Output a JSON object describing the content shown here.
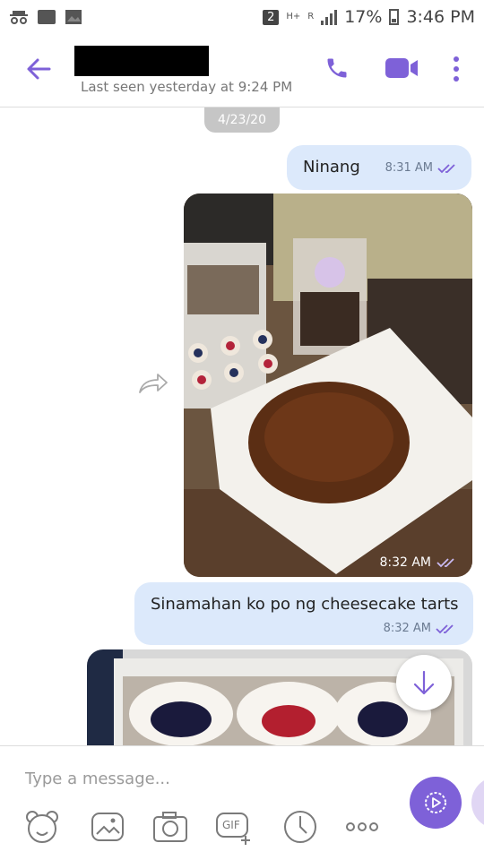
{
  "status_bar": {
    "notification_count": "2",
    "network_type": "H+",
    "roaming": "R",
    "battery": "17%",
    "time": "3:46 PM"
  },
  "header": {
    "last_seen": "Last seen yesterday at 9:24 PM",
    "icons": [
      "back-arrow-icon",
      "phone-icon",
      "video-icon",
      "more-vertical-icon"
    ],
    "accent_color": "#7e61d8"
  },
  "chat": {
    "date_label": "4/23/20",
    "messages": [
      {
        "type": "text",
        "text": "Ninang",
        "time": "8:31 AM",
        "status": "read"
      },
      {
        "type": "image",
        "time": "8:32 AM",
        "status": "read"
      },
      {
        "type": "text",
        "text": "Sinamahan ko po ng cheesecake tarts",
        "time": "8:32 AM",
        "status": "read"
      },
      {
        "type": "image",
        "status": "partial"
      }
    ],
    "bubble_color": "#dce9fb"
  },
  "composer": {
    "placeholder": "Type a message...",
    "tools": [
      "sticker-icon",
      "gallery-icon",
      "camera-icon",
      "gif-icon",
      "timer-icon",
      "more-horizontal-icon"
    ],
    "gif_label": "GIF"
  }
}
